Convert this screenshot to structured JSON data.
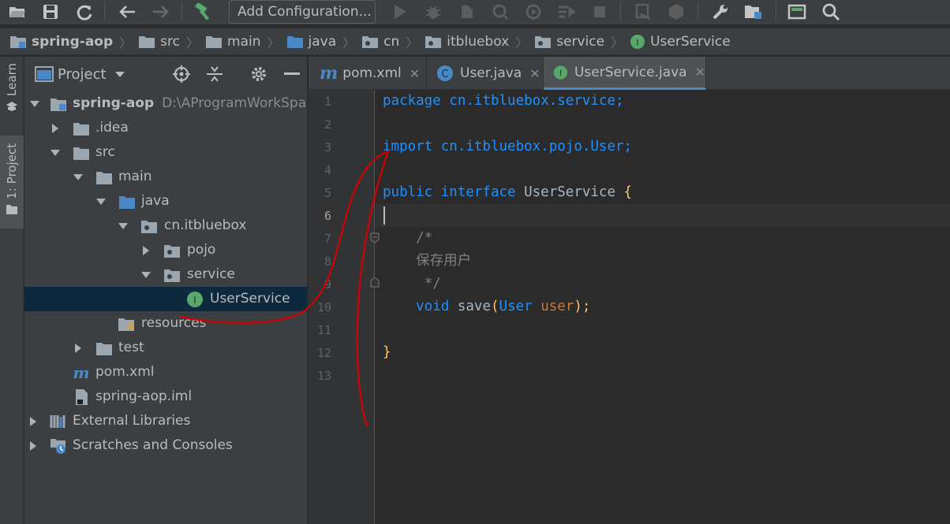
{
  "toolbar": {
    "run_config": "Add Configuration..."
  },
  "breadcrumb": {
    "items": [
      "spring-aop",
      "src",
      "main",
      "java",
      "cn",
      "itbluebox",
      "service",
      "UserService"
    ]
  },
  "side_strip": {
    "learn": "Learn",
    "project": "1: Project"
  },
  "project_panel": {
    "title": "Project",
    "tree": [
      {
        "label": "spring-aop",
        "hint": "D:\\AProgramWorkSpace"
      },
      {
        "label": ".idea"
      },
      {
        "label": "src"
      },
      {
        "label": "main"
      },
      {
        "label": "java"
      },
      {
        "label": "cn.itbluebox"
      },
      {
        "label": "pojo"
      },
      {
        "label": "service"
      },
      {
        "label": "UserService"
      },
      {
        "label": "resources"
      },
      {
        "label": "test"
      },
      {
        "label": "pom.xml"
      },
      {
        "label": "spring-aop.iml"
      },
      {
        "label": "External Libraries"
      },
      {
        "label": "Scratches and Consoles"
      }
    ]
  },
  "tabs": [
    {
      "label": "pom.xml"
    },
    {
      "label": "User.java"
    },
    {
      "label": "UserService.java"
    }
  ],
  "editor": {
    "line_numbers": [
      "1",
      "2",
      "3",
      "4",
      "5",
      "6",
      "7",
      "8",
      "9",
      "10",
      "11",
      "12",
      "13"
    ],
    "code": {
      "l1_kw": "package",
      "l1_rest": " cn.itbluebox.service;",
      "l3_kw": "import",
      "l3_rest": " cn.itbluebox.pojo.User;",
      "l5_kw1": "public",
      "l5_kw2": " interface",
      "l5_name": " UserService",
      "l5_brace": " {",
      "l7": "    /*",
      "l8": "    保存用户",
      "l9": "     */",
      "l10_kw": "    void",
      "l10_name": " save",
      "l10_p1": "(",
      "l10_type": "User",
      "l10_param": " user",
      "l10_p2": ");",
      "l12": "}"
    }
  },
  "colors": {
    "annotation": "#d40000",
    "selection": "#0d293e",
    "accent": "#4a88c7"
  }
}
